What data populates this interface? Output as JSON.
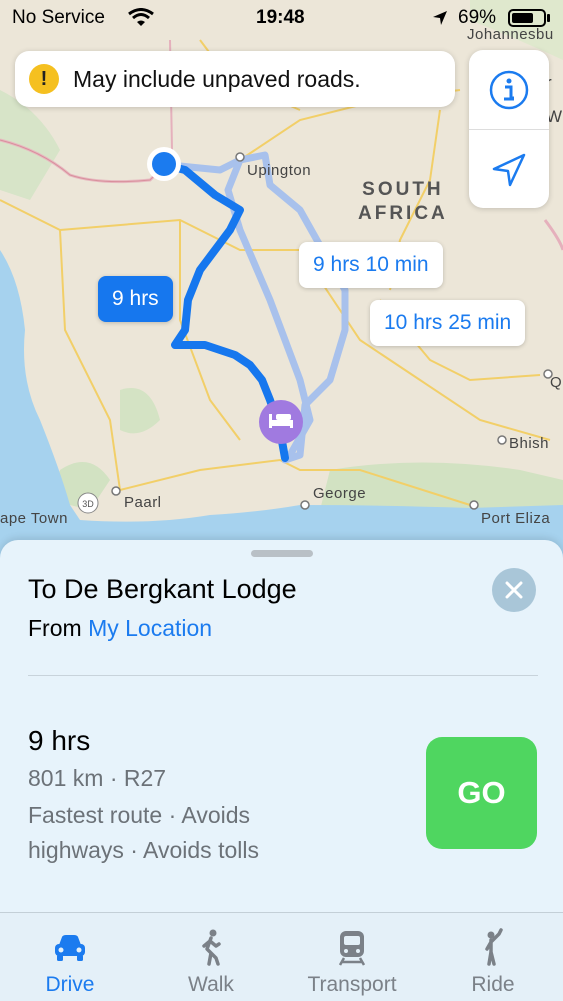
{
  "status_bar": {
    "carrier": "No Service",
    "time": "19:48",
    "battery": "69%",
    "battery_level": 0.69
  },
  "warning": {
    "icon": "exclamation-icon",
    "text": "May include unpaved roads."
  },
  "map_controls": {
    "info_icon": "info-icon",
    "location_icon": "location-arrow-icon"
  },
  "map": {
    "places": {
      "johannesburg": "Johannesbu",
      "upington": "Upington",
      "paarl": "Paarl",
      "cape_town": "ape Town",
      "george": "George",
      "port_elizabeth": "Port Eliza",
      "bhisho": "Bhish",
      "country_line1": "SOUTH",
      "country_line2": "AFRICA",
      "edge_r1": "r",
      "edge_r2": "W",
      "edge_q": "Q",
      "badge_3d": "3D"
    },
    "routes": [
      {
        "label": "9 hrs",
        "selected": true
      },
      {
        "label": "9 hrs 10 min",
        "selected": false
      },
      {
        "label": "10 hrs 25 min",
        "selected": false
      }
    ]
  },
  "sheet": {
    "title": "To De Bergkant Lodge",
    "from_prefix": "From",
    "from_link": "My Location",
    "route": {
      "duration": "9 hrs",
      "summary": "801 km · R27",
      "notes_line1": "Fastest route · Avoids",
      "notes_line2": "highways · Avoids tolls"
    },
    "go_label": "GO"
  },
  "tabs": [
    {
      "label": "Drive",
      "icon": "car-icon",
      "active": true
    },
    {
      "label": "Walk",
      "icon": "walking-person-icon",
      "active": false
    },
    {
      "label": "Transport",
      "icon": "train-icon",
      "active": false
    },
    {
      "label": "Ride",
      "icon": "hailing-person-icon",
      "active": false
    }
  ],
  "colors": {
    "accent": "#1b7bef",
    "go": "#4fd660",
    "warning": "#f5c020",
    "route_selected": "#1677ee",
    "route_alt": "#a8c1ec"
  }
}
